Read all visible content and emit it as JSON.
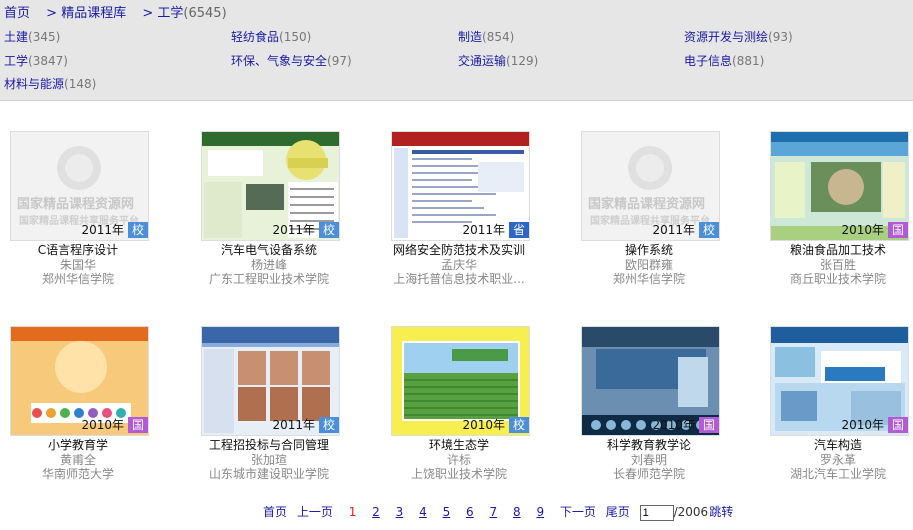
{
  "breadcrumb": {
    "home": "首页",
    "sep1": ">",
    "library": "精品课程库",
    "sep2": ">",
    "current": "工学",
    "count": "(6545)"
  },
  "categories": [
    {
      "name": "土建",
      "count": "(345)"
    },
    {
      "name": "轻纺食品",
      "count": "(150)"
    },
    {
      "name": "制造",
      "count": "(854)"
    },
    {
      "name": "资源开发与测绘",
      "count": "(93)"
    },
    {
      "name": "工学",
      "count": "(3847)"
    },
    {
      "name": "环保、气象与安全",
      "count": "(97)"
    },
    {
      "name": "交通运输",
      "count": "(129)"
    },
    {
      "name": "电子信息",
      "count": "(881)"
    },
    {
      "name": "材料与能源",
      "count": "(148)"
    }
  ],
  "watermark": {
    "line1": "国家精品课程资源网",
    "line2": "国家精品课程共享服务平台"
  },
  "courses": [
    {
      "title": "C语言程序设计",
      "teacher": "朱国华",
      "school": "郑州华信学院",
      "year": "2011年",
      "level": "校",
      "thumb": "watermark"
    },
    {
      "title": "汽车电气设备系统",
      "teacher": "杨进峰",
      "school": "广东工程职业技术学院",
      "year": "2011年",
      "level": "校",
      "thumb": "car"
    },
    {
      "title": "网络安全防范技术及实训",
      "teacher": "孟庆华",
      "school": "上海托普信息技术职业...",
      "year": "2011年",
      "level": "省",
      "thumb": "web"
    },
    {
      "title": "操作系统",
      "teacher": "欧阳群雍",
      "school": "郑州华信学院",
      "year": "2011年",
      "level": "校",
      "thumb": "watermark"
    },
    {
      "title": "粮油食品加工技术",
      "teacher": "张百胜",
      "school": "商丘职业技术学院",
      "year": "2010年",
      "level": "国",
      "thumb": "food"
    },
    {
      "title": "小学教育学",
      "teacher": "黄甫全",
      "school": "华南师范大学",
      "year": "2010年",
      "level": "国",
      "thumb": "edu"
    },
    {
      "title": "工程招投标与合同管理",
      "teacher": "张加瑄",
      "school": "山东城市建设职业学院",
      "year": "2011年",
      "level": "校",
      "thumb": "people"
    },
    {
      "title": "环境生态学",
      "teacher": "许标",
      "school": "上饶职业技术学院",
      "year": "2010年",
      "level": "校",
      "thumb": "tea"
    },
    {
      "title": "科学教育教学论",
      "teacher": "刘春明",
      "school": "长春师范学院",
      "year": "2010年",
      "level": "国",
      "thumb": "sci"
    },
    {
      "title": "汽车构造",
      "teacher": "罗永革",
      "school": "湖北汽车工业学院",
      "year": "2010年",
      "level": "国",
      "thumb": "auto"
    }
  ],
  "pager": {
    "first": "首页",
    "prev": "上一页",
    "pages": [
      "1",
      "2",
      "3",
      "4",
      "5",
      "6",
      "7",
      "8",
      "9"
    ],
    "current": "1",
    "next": "下一页",
    "last": "尾页",
    "input_value": "1",
    "total": "/2006",
    "go": "跳转"
  }
}
